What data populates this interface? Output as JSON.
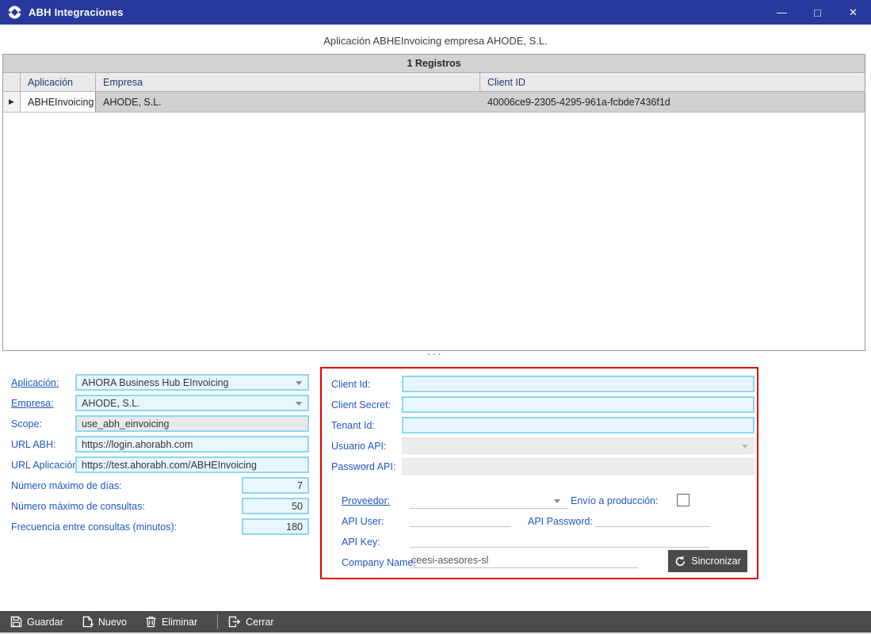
{
  "titlebar": {
    "title": "ABH Integraciones",
    "minimize_glyph": "—",
    "maximize_glyph": "□",
    "close_glyph": "✕"
  },
  "subtitle": "Aplicación ABHEInvoicing empresa AHODE, S.L.",
  "grid": {
    "count_header": "1 Registros",
    "columns": {
      "aplicacion": "Aplicación",
      "empresa": "Empresa",
      "client_id": "Client ID"
    },
    "row": {
      "aplicacion": "ABHEInvoicing",
      "empresa": "AHODE, S.L.",
      "client_id": "40006ce9-2305-4295-961a-fcbde7436f1d"
    },
    "selector_glyph": "▶"
  },
  "splitter_glyph": "···",
  "left_form": {
    "aplicacion": {
      "label": "Aplicación:",
      "value": "AHORA Business Hub EInvoicing"
    },
    "empresa": {
      "label": "Empresa:",
      "value": "AHODE, S.L."
    },
    "scope": {
      "label": "Scope:",
      "value": "use_abh_einvoicing"
    },
    "url_abh": {
      "label": "URL ABH:",
      "value": "https://login.ahorabh.com"
    },
    "url_app": {
      "label": "URL Aplicación:",
      "value": "https://test.ahorabh.com/ABHEInvoicing"
    },
    "max_dias": {
      "label": "Número máximo de días:",
      "value": "7"
    },
    "max_consultas": {
      "label": "Número máximo de consultas:",
      "value": "50"
    },
    "frecuencia": {
      "label": "Frecuencia entre consultas (minutos):",
      "value": "180"
    }
  },
  "right_form": {
    "client_id": {
      "label": "Client Id:",
      "value": ""
    },
    "client_secret": {
      "label": "Client Secret:",
      "value": ""
    },
    "tenant_id": {
      "label": "Tenant Id:",
      "value": ""
    },
    "usuario_api": {
      "label": "Usuario API:",
      "value": ""
    },
    "password_api": {
      "label": "Password API:",
      "value": ""
    },
    "proveedor": {
      "label": "Proveedor:",
      "value": ""
    },
    "envio_produccion": {
      "label": "Envío a producción:",
      "checked": false
    },
    "api_user": {
      "label": "API User:",
      "value": ""
    },
    "api_password": {
      "label": "API Password:",
      "value": ""
    },
    "api_key": {
      "label": "API Key:",
      "value": ""
    },
    "company_name": {
      "label": "Company Name:",
      "value": "ceesi-asesores-sl"
    },
    "sincronizar_label": "Sincronizar"
  },
  "toolbar": {
    "guardar": "Guardar",
    "nuevo": "Nuevo",
    "eliminar": "Eliminar",
    "cerrar": "Cerrar"
  },
  "colors": {
    "titlebar_blue": "#28399e",
    "label_blue": "#2356c0",
    "grid_header_text": "#1e3a70",
    "input_border_blue": "#8bd7f6",
    "input_bg_blue": "#e8f7fe",
    "disabled_gray": "#ededed",
    "selected_row_gray": "#d0d0d0",
    "red_panel_border": "#e00505",
    "toolbar_gray": "#4b4b4b"
  }
}
